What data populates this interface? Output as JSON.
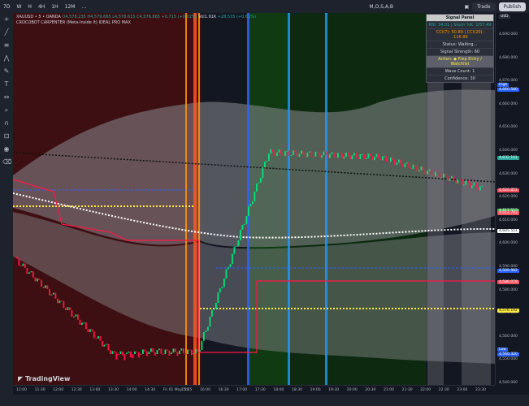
{
  "topbar": {
    "interval_items": [
      "7D",
      "W",
      "H",
      "4H",
      "1H",
      "12M",
      "…"
    ],
    "toolbar_text": "M,O,S,A,B",
    "trade_label": "Trade",
    "publish_label": "Publish"
  },
  "legend": {
    "symbol": "XAUUSD • 5 • OANDA",
    "ohlc": "O4,578.235 H4,579.665 L4,578.615 C4,578.865 +0.715 (+0.02%)",
    "vol": "Vol1.91K",
    "extra": "+28.535 (+0.61%)",
    "indicator": "CROCOBOT CARPENTER (Meta-Inside It) IDEAL PRO MAX"
  },
  "signal_panel": {
    "title": "Signal Panel",
    "rsi": "RSI: 34.01 | Stoch %K: 1/57.49",
    "cci": "CCI(7): 50.89 | CCI(20): -116.86",
    "status": "Status: Waiting...",
    "strength": "Signal Strength: 60",
    "action": "Action: ◆ Prep Entry / Watchlist",
    "wave": "Wave Count: 1",
    "confidence": "Confidence: 30"
  },
  "right_axis": {
    "currency": "USD",
    "ticks": [
      "4,690.000",
      "4,680.000",
      "4,670.000",
      "4,660.000",
      "4,650.000",
      "4,640.000",
      "4,630.000",
      "4,620.000",
      "4,610.000",
      "4,600.000",
      "4,590.000",
      "4,580.000",
      "4,570.000",
      "4,560.000",
      "4,550.000",
      "4,540.000"
    ],
    "tags": [
      {
        "text": "High",
        "color": "#2962ff"
      },
      {
        "text": "4,660.580",
        "color": "#2962ff"
      },
      {
        "text": "4,632.191",
        "color": "#26a69a"
      },
      {
        "text": "4,620.851",
        "color": "#f7525f"
      },
      {
        "text": "4,617.515",
        "color": "#4caf50"
      },
      {
        "text": "4,612.783",
        "color": "#f7525f"
      },
      {
        "text": "4,605.551",
        "color": "#ffffff"
      },
      {
        "text": "4,589.982",
        "color": "#2962ff"
      },
      {
        "text": "4,586.078",
        "color": "#f7525f"
      },
      {
        "text": "4,576.192",
        "color": "#ffeb3b"
      },
      {
        "text": "Low",
        "color": "#2962ff"
      },
      {
        "text": "4,560.320",
        "color": "#2962ff"
      }
    ]
  },
  "time_axis": [
    "11:00",
    "11:30",
    "12:00",
    "12:30",
    "13:00",
    "13:30",
    "14:00",
    "14:30",
    "Fri 01 May '26",
    "15:25",
    "16:00",
    "16:30",
    "17:00",
    "17:30",
    "18:00",
    "18:30",
    "19:00",
    "19:30",
    "20:00",
    "20:30",
    "21:00",
    "21:30",
    "22:00",
    "22:30",
    "23:00",
    "23:30"
  ],
  "brand": "TradingView",
  "colors": {
    "up": "#00e676",
    "down": "#ff1744",
    "bg": "#131722"
  }
}
